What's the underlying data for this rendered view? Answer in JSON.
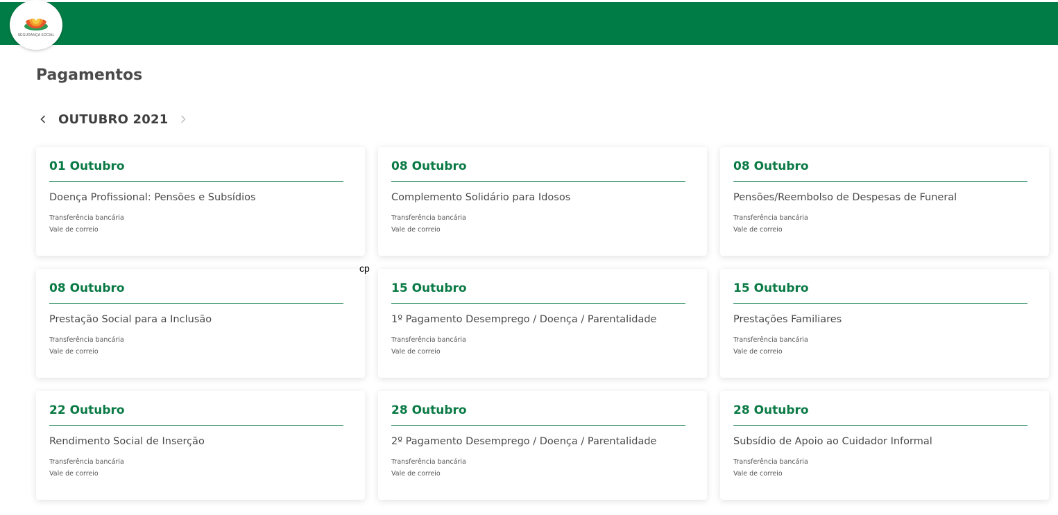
{
  "header": {
    "brand_color": "#007d46",
    "logo_text": "SEGURANÇA SOCIAL"
  },
  "page_title": "Pagamentos",
  "month_nav": {
    "month": "OUTUBRO 2021",
    "prev_icon": "chevron-left-icon",
    "next_icon": "chevron-right-icon"
  },
  "stray_text": "cp",
  "cards": [
    {
      "date": "01 Outubro",
      "title": "Doença Profissional: Pensões e Subsídios",
      "methods": [
        "Transferência bancária",
        "Vale de correio"
      ]
    },
    {
      "date": "08 Outubro",
      "title": "Complemento Solidário para Idosos",
      "methods": [
        "Transferência bancária",
        "Vale de correio"
      ]
    },
    {
      "date": "08 Outubro",
      "title": "Pensões/Reembolso de Despesas de Funeral",
      "methods": [
        "Transferência bancária",
        "Vale de correio"
      ]
    },
    {
      "date": "08 Outubro",
      "title": "Prestação Social para a Inclusão",
      "methods": [
        "Transferência bancária",
        "Vale de correio"
      ]
    },
    {
      "date": "15 Outubro",
      "title": "1º Pagamento Desemprego / Doença / Parentalidade",
      "methods": [
        "Transferência bancária",
        "Vale de correio"
      ]
    },
    {
      "date": "15 Outubro",
      "title": "Prestações Familiares",
      "methods": [
        "Transferência bancária",
        "Vale de correio"
      ]
    },
    {
      "date": "22 Outubro",
      "title": "Rendimento Social de Inserção",
      "methods": [
        "Transferência bancária",
        "Vale de correio"
      ]
    },
    {
      "date": "28 Outubro",
      "title": "2º Pagamento Desemprego / Doença / Parentalidade",
      "methods": [
        "Transferência bancária",
        "Vale de correio"
      ]
    },
    {
      "date": "28 Outubro",
      "title": "Subsídio de Apoio ao Cuidador Informal",
      "methods": [
        "Transferência bancária",
        "Vale de correio"
      ]
    }
  ]
}
